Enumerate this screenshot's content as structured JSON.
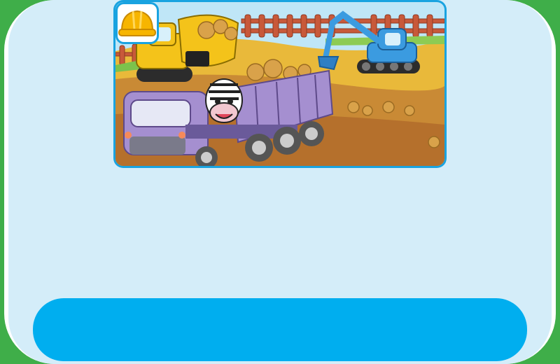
{
  "colors": {
    "frame_green": "#3fae49",
    "panel_bg": "#d4edf9",
    "accent_blue": "#00aeef"
  },
  "scene": {
    "icon": "construction-scene-illustration",
    "badge_icon": "hard-hat-icon"
  },
  "bottom_button": {
    "label": ""
  }
}
